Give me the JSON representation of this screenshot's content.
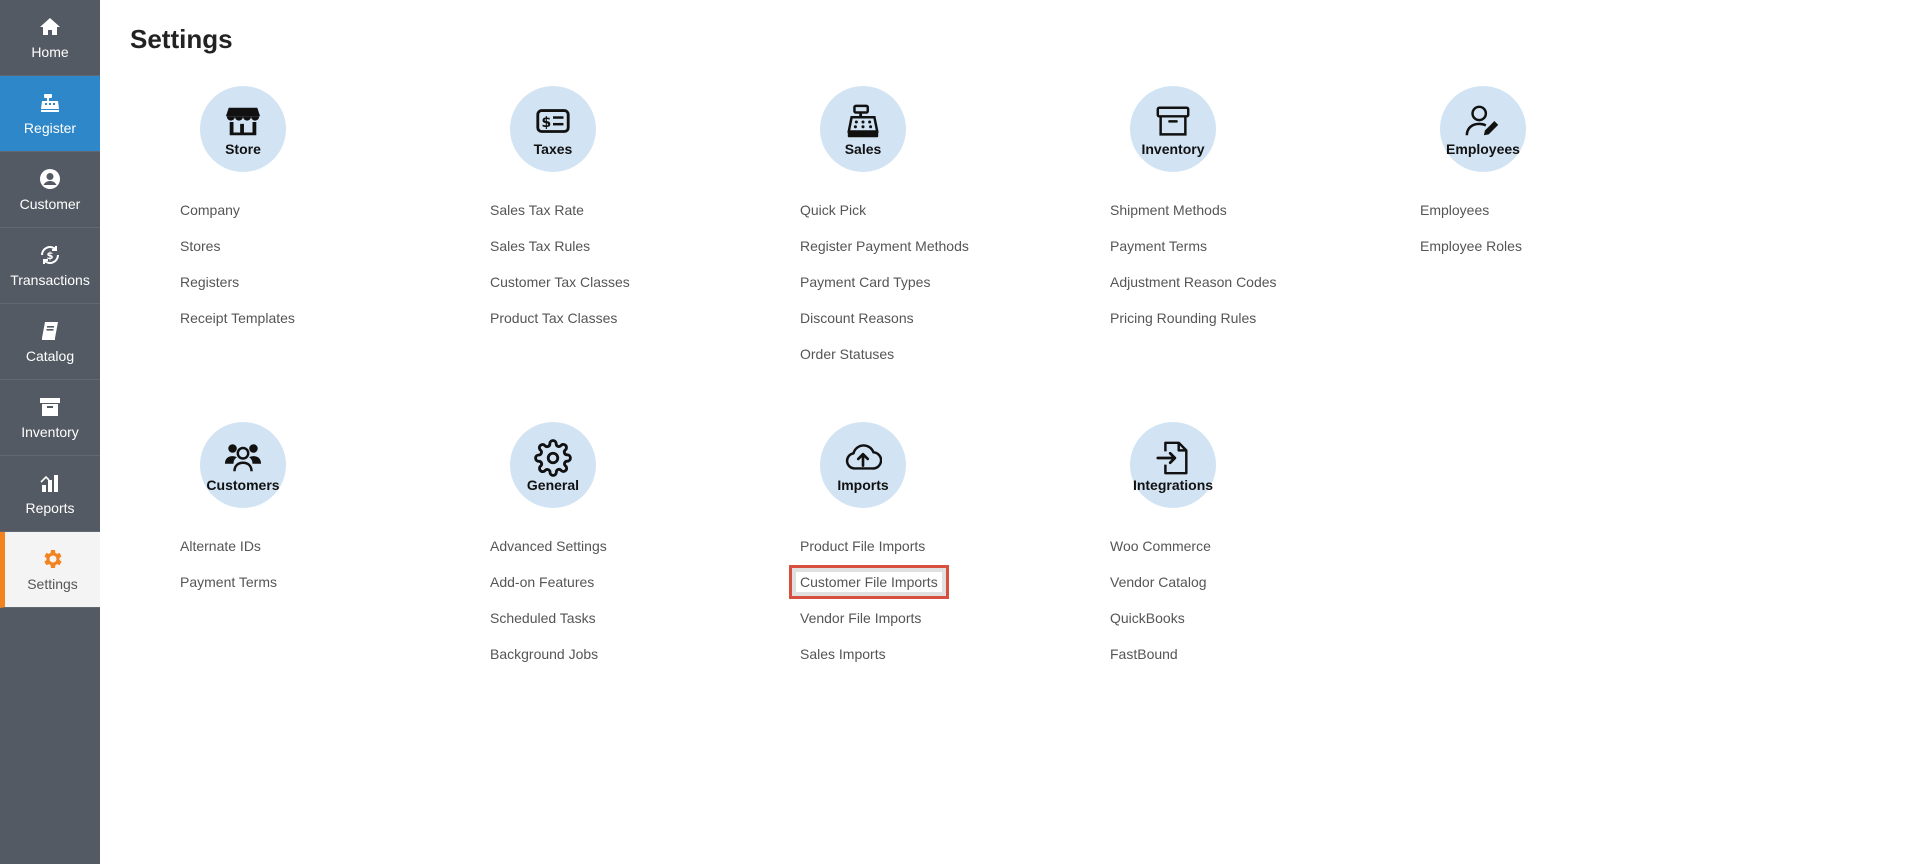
{
  "sidebar": {
    "items": [
      {
        "label": "Home",
        "icon": "home-icon"
      },
      {
        "label": "Register",
        "icon": "cash-register-icon"
      },
      {
        "label": "Customer",
        "icon": "user-circle-icon"
      },
      {
        "label": "Transactions",
        "icon": "dollar-cycle-icon"
      },
      {
        "label": "Catalog",
        "icon": "book-icon"
      },
      {
        "label": "Inventory",
        "icon": "archive-box-icon"
      },
      {
        "label": "Reports",
        "icon": "bar-chart-icon"
      },
      {
        "label": "Settings",
        "icon": "gear-icon"
      }
    ],
    "active_color": "#2d87c8",
    "settings_accent": "#f2831f"
  },
  "page": {
    "title": "Settings"
  },
  "sections": {
    "store": {
      "label": "Store",
      "icon": "store-icon",
      "links": [
        "Company",
        "Stores",
        "Registers",
        "Receipt Templates"
      ]
    },
    "taxes": {
      "label": "Taxes",
      "icon": "receipt-dollar-icon",
      "links": [
        "Sales Tax Rate",
        "Sales Tax Rules",
        "Customer Tax Classes",
        "Product Tax Classes"
      ]
    },
    "sales": {
      "label": "Sales",
      "icon": "cash-register-icon",
      "links": [
        "Quick Pick",
        "Register Payment Methods",
        "Payment Card Types",
        "Discount Reasons",
        "Order Statuses"
      ]
    },
    "inventory": {
      "label": "Inventory",
      "icon": "archive-box-icon",
      "links": [
        "Shipment Methods",
        "Payment Terms",
        "Adjustment Reason Codes",
        "Pricing Rounding Rules"
      ]
    },
    "employees": {
      "label": "Employees",
      "icon": "user-edit-icon",
      "links": [
        "Employees",
        "Employee Roles"
      ]
    },
    "customers": {
      "label": "Customers",
      "icon": "users-icon",
      "links": [
        "Alternate IDs",
        "Payment Terms"
      ]
    },
    "general": {
      "label": "General",
      "icon": "gear-icon",
      "links": [
        "Advanced Settings",
        "Add-on Features",
        "Scheduled Tasks",
        "Background Jobs"
      ]
    },
    "imports": {
      "label": "Imports",
      "icon": "cloud-upload-icon",
      "links": [
        "Product File Imports",
        "Customer File Imports",
        "Vendor File Imports",
        "Sales Imports"
      ]
    },
    "integrations": {
      "label": "Integrations",
      "icon": "file-import-icon",
      "links": [
        "Woo Commerce",
        "Vendor Catalog",
        "QuickBooks",
        "FastBound"
      ]
    }
  },
  "highlight": {
    "section": "imports",
    "link": "Customer File Imports",
    "color": "#d64f3f"
  }
}
